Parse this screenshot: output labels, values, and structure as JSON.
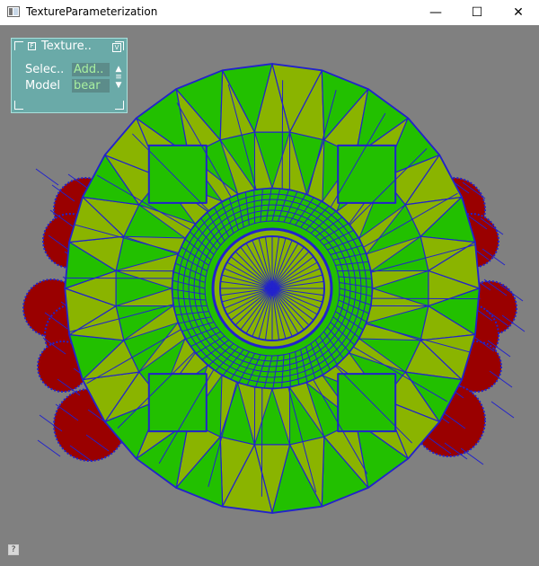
{
  "window": {
    "title": "TextureParameterization",
    "icon": "app-window-icon",
    "controls": {
      "minimize": "—",
      "maximize": "☐",
      "close": "✕"
    }
  },
  "gui_panel": {
    "title": "Texture..",
    "rows": [
      {
        "label": "Selec..",
        "value": "Add.."
      },
      {
        "label": "Model",
        "value": "bear"
      }
    ],
    "scroll_glyphs": {
      "up": "▲",
      "mid": "≡",
      "down": "▼"
    },
    "f_glyph": "F",
    "collapse_glyph": "V"
  },
  "help": {
    "glyph": "?"
  },
  "colors": {
    "background": "#808080",
    "wire": "#2222cc",
    "face_green": "#22c000",
    "face_yellowgreen": "#8ab400",
    "face_red": "#9a0000"
  }
}
